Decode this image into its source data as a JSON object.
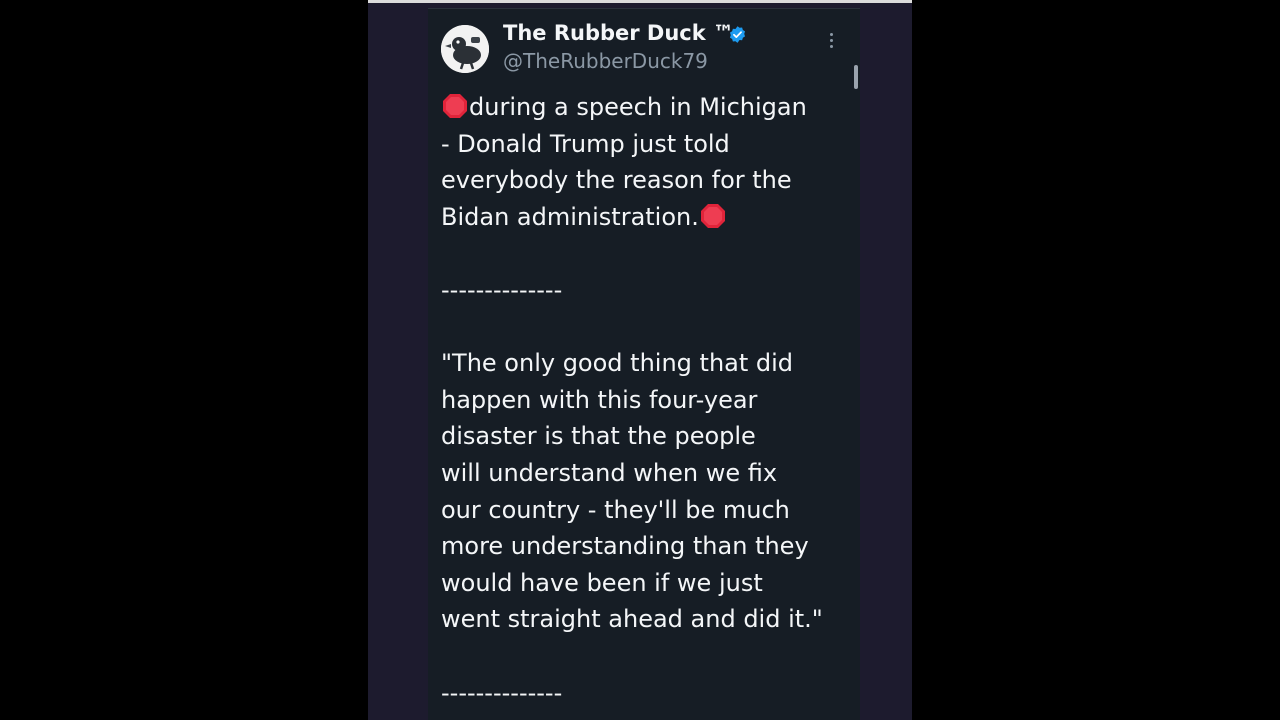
{
  "post": {
    "author_name": "The Rubber Duck ™",
    "author_handle": "@TheRubberDuck79",
    "intro_lines": [
      "during a speech in Michigan",
      "- Donald Trump just told",
      "everybody the reason for the",
      "Bidan administration."
    ],
    "separator": "--------------",
    "quote_lines": [
      "\"The only good thing that did",
      "happen with this four-year",
      "disaster is that the people",
      "will understand when we fix",
      "our country - they'll be much",
      "more understanding than they",
      "would have been if we just",
      "went straight ahead and did it.\""
    ],
    "separator_bottom": "--------------"
  },
  "icons": {
    "verified": "verified-badge-icon",
    "stop_sign": "stop-sign-emoji-icon",
    "more": "more-options-icon"
  },
  "colors": {
    "page_background": "#000000",
    "frame_background": "#1d1b2e",
    "card_background": "#161d25",
    "primary_text": "#f4f6f8",
    "secondary_text": "#8b98a5",
    "verified_blue": "#1d9bf0",
    "stop_red": "#e0243a"
  }
}
